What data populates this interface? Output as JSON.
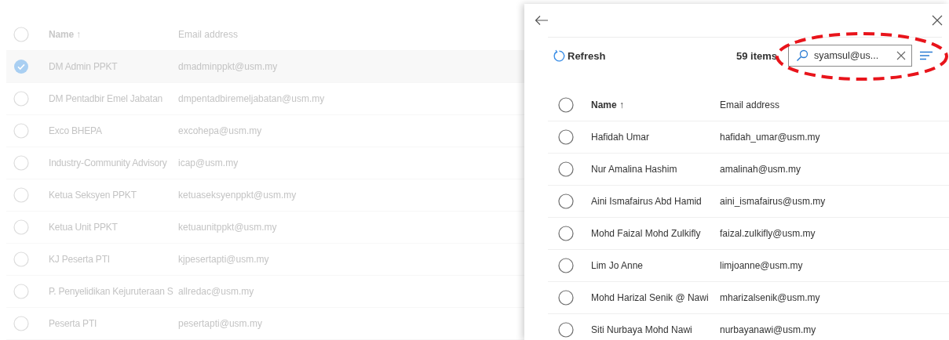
{
  "background_list": {
    "select_all": {
      "selected": false
    },
    "columns": [
      {
        "label": "Name ↑"
      },
      {
        "label": "Email address"
      }
    ],
    "rows": [
      {
        "name": "DM Admin PPKT",
        "email": "dmadminppkt@usm.my",
        "selected": true
      },
      {
        "name": "DM Pentadbir Emel Jabatan",
        "email": "dmpentadbiremeljabatan@usm.my",
        "selected": false
      },
      {
        "name": "Exco BHEPA",
        "email": "excohepa@usm.my",
        "selected": false
      },
      {
        "name": "Industry-Community Advisory",
        "email": "icap@usm.my",
        "selected": false
      },
      {
        "name": "Ketua Seksyen PPKT",
        "email": "ketuaseksyenppkt@usm.my",
        "selected": false
      },
      {
        "name": "Ketua Unit PPKT",
        "email": "ketuaunitppkt@usm.my",
        "selected": false
      },
      {
        "name": "KJ Peserta PTI",
        "email": "kjpesertapti@usm.my",
        "selected": false
      },
      {
        "name": "P. Penyelidikan Kejuruteraan S",
        "email": "allredac@usm.my",
        "selected": false
      },
      {
        "name": "Peserta PTI",
        "email": "pesertapti@usm.my",
        "selected": false
      }
    ]
  },
  "panel": {
    "toolbar": {
      "refresh": "Refresh",
      "count": "59 items"
    },
    "search": {
      "value": "syamsul@us..."
    },
    "annotation": {
      "kind": "dashed-ellipse"
    },
    "table": {
      "select_all": {
        "selected": false
      },
      "columns": [
        {
          "label": "Name ↑"
        },
        {
          "label": "Email address"
        }
      ],
      "rows": [
        {
          "name": "Hafidah Umar",
          "email": "hafidah_umar@usm.my",
          "selected": false
        },
        {
          "name": "Nur Amalina Hashim",
          "email": "amalinah@usm.my",
          "selected": false
        },
        {
          "name": "Aini Ismafairus Abd Hamid",
          "email": "aini_ismafairus@usm.my",
          "selected": false
        },
        {
          "name": "Mohd Faizal Mohd Zulkifly",
          "email": "faizal.zulkifly@usm.my",
          "selected": false
        },
        {
          "name": "Lim Jo Anne",
          "email": "limjoanne@usm.my",
          "selected": false
        },
        {
          "name": "Mohd Harizal Senik @ Nawi",
          "email": "mharizalsenik@usm.my",
          "selected": false
        },
        {
          "name": "Siti Nurbaya Mohd Nawi",
          "email": "nurbayanawi@usm.my",
          "selected": false
        }
      ]
    }
  }
}
